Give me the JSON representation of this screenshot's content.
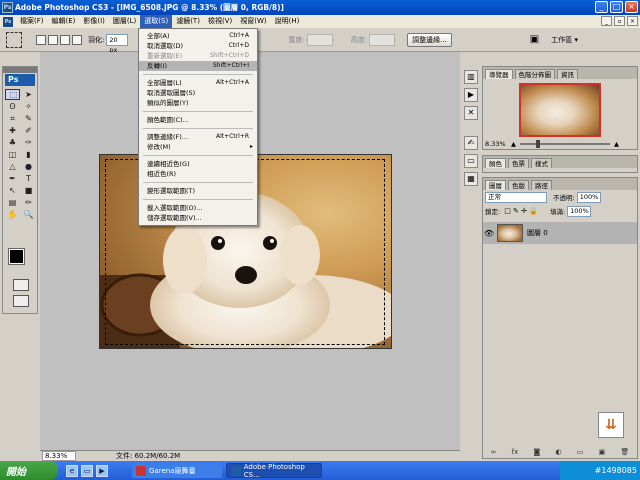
{
  "window": {
    "title": "Adobe Photoshop CS3 - [IMG_6508.JPG @ 8.33% (圖層 0, RGB/8)]"
  },
  "menubar": {
    "items": [
      "檔案(F)",
      "編輯(E)",
      "影像(I)",
      "圖層(L)",
      "選取(S)",
      "濾鏡(T)",
      "檢視(V)",
      "視窗(W)",
      "說明(H)"
    ],
    "active_index": 4
  },
  "options": {
    "feather_label": "羽化:",
    "feather_value": "20 px",
    "width_label": "寬度:",
    "height_label": "高度:",
    "refine_edge": "調整邊緣...",
    "workspace": "工作區 ▾"
  },
  "select_menu": {
    "items": [
      {
        "label": "全部(A)",
        "shortcut": "Ctrl+A",
        "state": "normal"
      },
      {
        "label": "取消選取(D)",
        "shortcut": "Ctrl+D",
        "state": "normal"
      },
      {
        "label": "重新選取(E)",
        "shortcut": "Shift+Ctrl+D",
        "state": "disabled"
      },
      {
        "label": "反轉(I)",
        "shortcut": "Shift+Ctrl+I",
        "state": "highlighted"
      },
      {
        "label": "全部圖層(L)",
        "shortcut": "Alt+Ctrl+A",
        "state": "normal"
      },
      {
        "label": "取消選取圖層(S)",
        "shortcut": "",
        "state": "normal"
      },
      {
        "label": "類似的圖層(Y)",
        "shortcut": "",
        "state": "normal"
      },
      {
        "label": "顏色範圍(C)...",
        "shortcut": "",
        "state": "normal"
      },
      {
        "label": "調整邊緣(F)...",
        "shortcut": "Alt+Ctrl+R",
        "state": "normal"
      },
      {
        "label": "修改(M)",
        "shortcut": "",
        "state": "submenu"
      },
      {
        "label": "連續相近色(G)",
        "shortcut": "",
        "state": "normal"
      },
      {
        "label": "相近色(R)",
        "shortcut": "",
        "state": "normal"
      },
      {
        "label": "變形選取範圍(T)",
        "shortcut": "",
        "state": "normal"
      },
      {
        "label": "載入選取範圍(O)...",
        "shortcut": "",
        "state": "normal"
      },
      {
        "label": "儲存選取範圍(V)...",
        "shortcut": "",
        "state": "normal"
      }
    ]
  },
  "toolbox": {
    "logo": "Ps"
  },
  "navigator": {
    "tabs": [
      "導覽器",
      "色階分佈圖",
      "資訊"
    ],
    "zoom": "8.33%"
  },
  "color_panel": {
    "tabs": [
      "顏色",
      "色票",
      "樣式"
    ]
  },
  "layers_panel": {
    "tabs": [
      "圖層",
      "色版",
      "路徑"
    ],
    "blend_mode": "正常",
    "opacity_label": "不透明:",
    "opacity_value": "100%",
    "lock_label": "鎖定:",
    "fill_label": "填滿:",
    "fill_value": "100%",
    "layer_name": "圖層 0"
  },
  "statusbar": {
    "zoom": "8.33%",
    "doc_info": "文件: 60.2M/60.2M"
  },
  "taskbar": {
    "start": "開始",
    "tasks": [
      "Garena競舞臺",
      "Adobe Photoshop CS..."
    ],
    "watermark": "#1498085"
  }
}
